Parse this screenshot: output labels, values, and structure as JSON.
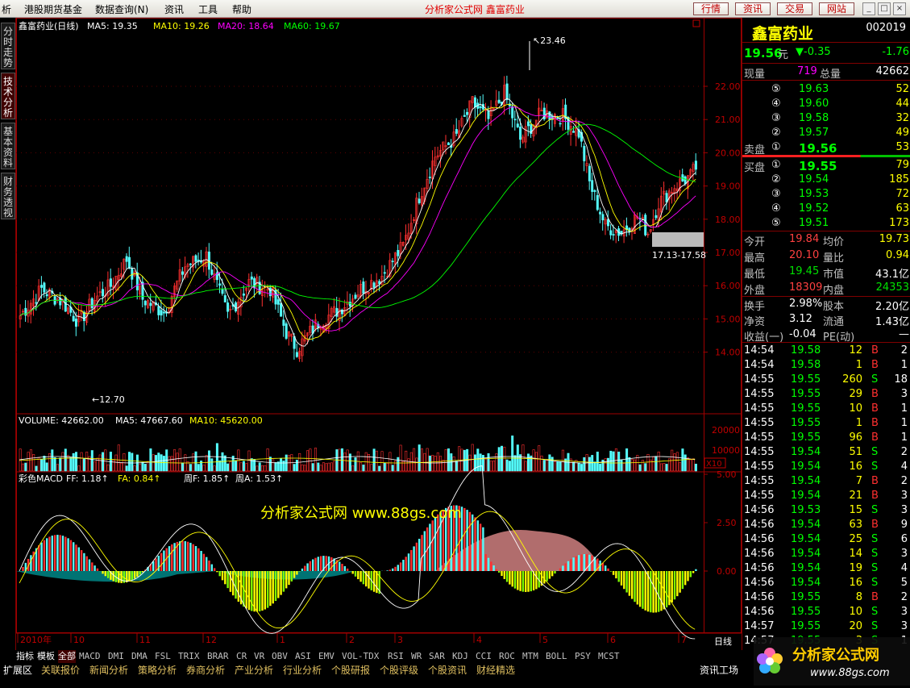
{
  "menubar": {
    "items": [
      "析",
      "港股期货基金",
      "数据查询(N)",
      "资讯",
      "工具",
      "帮助"
    ],
    "title": "分析家公式网 鑫富药业",
    "buttons": [
      "行情",
      "资讯",
      "交易",
      "网站"
    ],
    "win": [
      "_",
      "□",
      "×"
    ]
  },
  "sidetabs": [
    "分时走势",
    "技术分析",
    "基本资料",
    "财务透视"
  ],
  "main": {
    "legend_stock": "鑫富药业(日线)",
    "ma": [
      {
        "label": "MA5: 19.35",
        "color": "#ffffff"
      },
      {
        "label": "MA10: 19.26",
        "color": "#ffff00"
      },
      {
        "label": "MA20: 18.64",
        "color": "#ff00ff"
      },
      {
        "label": "MA60: 19.67",
        "color": "#00ff00"
      }
    ],
    "price_ticks": [
      "22.00",
      "21.00",
      "20.00",
      "19.00",
      "18.00",
      "17.00",
      "16.00",
      "15.00",
      "14.00"
    ],
    "high_label": "23.46",
    "low_label": "12.70",
    "zone_label": "17.13-17.58",
    "volume_legend": [
      "VOLUME: 42662.00",
      "MA5: 47667.60",
      "MA10: 45620.00"
    ],
    "volume_ticks": [
      "20000",
      "10000"
    ],
    "volume_unit": "X10",
    "macd_legend": [
      "彩色MACD",
      "FF: 1.18",
      "FA: 0.84",
      "周F: 1.85",
      "周A: 1.53"
    ],
    "macd_ticks": [
      "5.00",
      "2.50",
      "0.00"
    ],
    "watermark": "分析家公式网 www.88gs.com",
    "date_labels": [
      "2010年",
      "10",
      "11",
      "12",
      "1",
      "2",
      "3",
      "4",
      "5",
      "6",
      "7"
    ],
    "period": "日线"
  },
  "quote": {
    "name": "鑫富药业",
    "code": "002019",
    "price": "19.56",
    "unit": "元",
    "change": "▼-0.35",
    "pct": "-1.76",
    "now_vol_label": "现量",
    "now_vol": "719",
    "total_label": "总量",
    "total": "42662",
    "asks": [
      {
        "n": "⑤",
        "p": "19.63",
        "v": "52"
      },
      {
        "n": "④",
        "p": "19.60",
        "v": "44"
      },
      {
        "n": "③",
        "p": "19.58",
        "v": "32"
      },
      {
        "n": "②",
        "p": "19.57",
        "v": "49"
      },
      {
        "n": "①",
        "p": "19.56",
        "v": "53"
      }
    ],
    "sell_label": "卖盘",
    "buy_label": "买盘",
    "bids": [
      {
        "n": "①",
        "p": "19.55",
        "v": "79"
      },
      {
        "n": "②",
        "p": "19.54",
        "v": "185"
      },
      {
        "n": "③",
        "p": "19.53",
        "v": "72"
      },
      {
        "n": "④",
        "p": "19.52",
        "v": "63"
      },
      {
        "n": "⑤",
        "p": "19.51",
        "v": "173"
      }
    ],
    "stats": [
      {
        "l1": "今开",
        "v1": "19.84",
        "c1": "#ff4040",
        "l2": "均价",
        "v2": "19.73",
        "c2": "#ffff00"
      },
      {
        "l1": "最高",
        "v1": "20.10",
        "c1": "#ff4040",
        "l2": "量比",
        "v2": "0.94",
        "c2": "#ffff00"
      },
      {
        "l1": "最低",
        "v1": "19.45",
        "c1": "#00e000",
        "l2": "市值",
        "v2": "43.1亿",
        "c2": "#ffffff"
      },
      {
        "l1": "外盘",
        "v1": "18309",
        "c1": "#ff4040",
        "l2": "内盘",
        "v2": "24353",
        "c2": "#00e000"
      }
    ],
    "fin": [
      {
        "l1": "换手",
        "v1": "2.98%",
        "l2": "股本",
        "v2": "2.20亿"
      },
      {
        "l1": "净资",
        "v1": "3.12",
        "l2": "流通",
        "v2": "1.43亿"
      },
      {
        "l1": "收益(一)",
        "v1": "-0.04",
        "l2": "PE(动)",
        "v2": "—"
      }
    ],
    "ticks": [
      [
        "14:54",
        "19.58",
        "12",
        "B",
        "2"
      ],
      [
        "14:54",
        "19.58",
        "1",
        "B",
        "1"
      ],
      [
        "14:55",
        "19.55",
        "260",
        "S",
        "18"
      ],
      [
        "14:55",
        "19.55",
        "29",
        "B",
        "3"
      ],
      [
        "14:55",
        "19.55",
        "10",
        "B",
        "1"
      ],
      [
        "14:55",
        "19.55",
        "1",
        "B",
        "1"
      ],
      [
        "14:55",
        "19.55",
        "96",
        "B",
        "1"
      ],
      [
        "14:55",
        "19.54",
        "51",
        "S",
        "2"
      ],
      [
        "14:55",
        "19.54",
        "16",
        "S",
        "4"
      ],
      [
        "14:55",
        "19.54",
        "7",
        "B",
        "2"
      ],
      [
        "14:55",
        "19.54",
        "21",
        "B",
        "3"
      ],
      [
        "14:56",
        "19.53",
        "15",
        "S",
        "3"
      ],
      [
        "14:56",
        "19.54",
        "63",
        "B",
        "9"
      ],
      [
        "14:56",
        "19.54",
        "25",
        "S",
        "6"
      ],
      [
        "14:56",
        "19.54",
        "14",
        "S",
        "3"
      ],
      [
        "14:56",
        "19.54",
        "19",
        "S",
        "4"
      ],
      [
        "14:56",
        "19.54",
        "16",
        "S",
        "5"
      ],
      [
        "14:56",
        "19.55",
        "8",
        "B",
        "2"
      ],
      [
        "14:56",
        "19.55",
        "10",
        "S",
        "3"
      ],
      [
        "14:57",
        "19.55",
        "20",
        "S",
        "3"
      ],
      [
        "14:57",
        "19.55",
        "3",
        "S",
        "1"
      ]
    ]
  },
  "bottom": {
    "tabs1": [
      "指标",
      "模板",
      "全部",
      "MACD",
      "DMI",
      "DMA",
      "FSL",
      "TRIX",
      "BRAR",
      "CR",
      "VR",
      "OBV",
      "ASI",
      "EMV",
      "VOL-TDX",
      "RSI",
      "WR",
      "SAR",
      "KDJ",
      "CCI",
      "ROC",
      "MTM",
      "BOLL",
      "PSY",
      "MCST"
    ],
    "tabs2": [
      "扩展区",
      "关联报价",
      "新闻分析",
      "策略分析",
      "券商分析",
      "产业分析",
      "行业分析",
      "个股研报",
      "个股评级",
      "个股资讯",
      "财经精选"
    ],
    "right": "资讯工场",
    "logo_text": "分析家公式网",
    "logo_url": "www.88gs.com"
  },
  "colors": {
    "up": "#ff3030",
    "down": "#54fcfc",
    "frame": "#a00000",
    "ma5": "#ffffff",
    "ma10": "#ffff00",
    "ma20": "#ff00ff",
    "ma60": "#00ff00"
  }
}
